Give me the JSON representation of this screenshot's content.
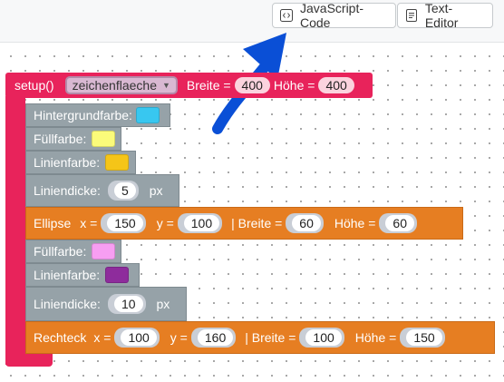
{
  "toolbar": {
    "js_label": "JavaScript-Code",
    "text_label": "Text-Editor",
    "js_icon": "code-icon",
    "text_icon": "document-icon"
  },
  "blocks": {
    "setup": {
      "label": "setup()",
      "canvas_select": "zeichenflaeche",
      "width_label": "Breite =",
      "width_value": "400",
      "height_label": "Höhe =",
      "height_value": "400"
    },
    "background": {
      "label": "Hintergrundfarbe:",
      "color": "#38c7f0"
    },
    "fill1": {
      "label": "Füllfarbe:",
      "color": "#fbfb7a"
    },
    "stroke1": {
      "label": "Linienfarbe:",
      "color": "#f5c518"
    },
    "strokeweight1": {
      "label": "Liniendicke:",
      "value": "5",
      "unit": "px"
    },
    "ellipse": {
      "label": "Ellipse",
      "x_label": "x =",
      "x_value": "150",
      "y_label": "y =",
      "y_value": "100",
      "w_label": "| Breite =",
      "w_value": "60",
      "h_label": "Höhe =",
      "h_value": "60"
    },
    "fill2": {
      "label": "Füllfarbe:",
      "color": "#f79ef2"
    },
    "stroke2": {
      "label": "Linienfarbe:",
      "color": "#8e2c9c"
    },
    "strokeweight2": {
      "label": "Liniendicke:",
      "value": "10",
      "unit": "px"
    },
    "rect": {
      "label": "Rechteck",
      "x_label": "x =",
      "x_value": "100",
      "y_label": "y =",
      "y_value": "160",
      "w_label": "| Breite =",
      "w_value": "100",
      "h_label": "Höhe =",
      "h_value": "150"
    }
  },
  "colors": {
    "setup": "#e8235b",
    "control": "#96a2a8",
    "shape": "#e67e22",
    "arrow": "#0a4fd6"
  }
}
